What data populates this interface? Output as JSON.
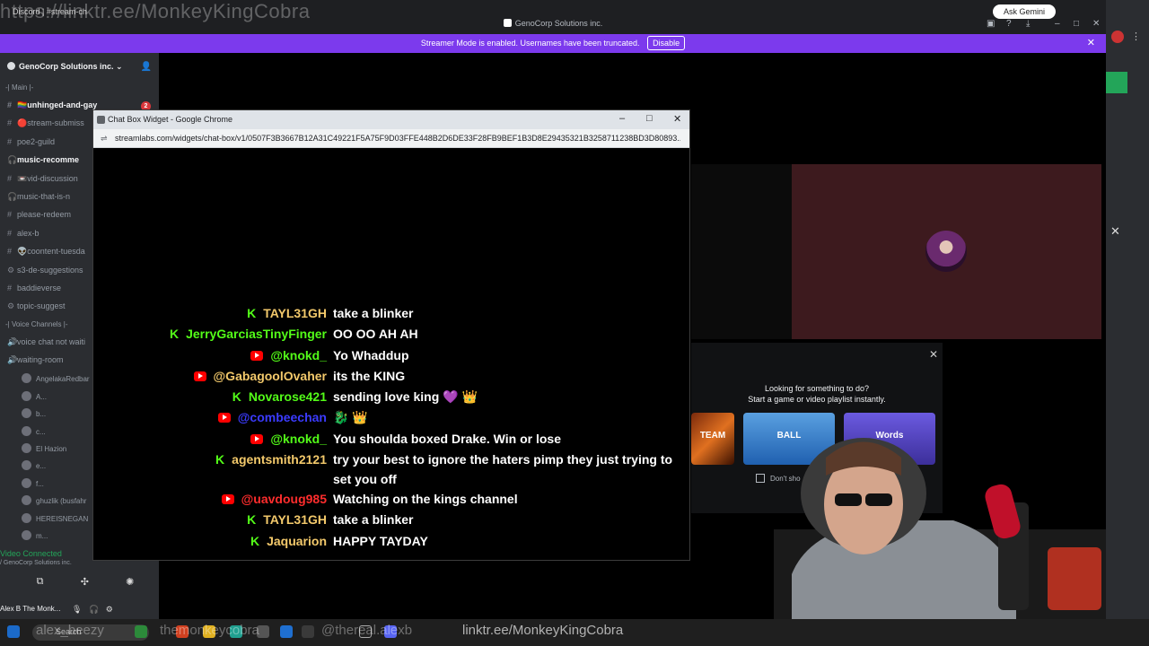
{
  "overlay": {
    "top_link": "https://linktr.ee/MonkeyKingCobra",
    "bottom_link": "linktr.ee/MonkeyKingCobra",
    "bottom_social_1": "themonkeycobra",
    "bottom_social_2": "@thereal.alexb",
    "bottom_social_3": "alex_beezy"
  },
  "discord": {
    "window_title": "GenoCorp Solutions inc.",
    "tab_mini": "Discord | #stream-ch",
    "ask_gemini": "Ask Gemini",
    "banner_text": "Streamer Mode is enabled. Usernames have been truncated.",
    "banner_button": "Disable",
    "server_name": "GenoCorp Solutions inc.",
    "categories": [
      "-| Main |-",
      "-| Voice Channels |-"
    ],
    "channels": [
      {
        "name": "🏳️‍🌈unhinged-and-gay",
        "icon": "#",
        "badge": "2",
        "unread": true
      },
      {
        "name": "🔴stream-submiss",
        "icon": "#",
        "badge": "",
        "unread": false
      },
      {
        "name": "poe2-guild",
        "icon": "#",
        "badge": "",
        "unread": false
      },
      {
        "name": "music-recomme",
        "icon": "🎧",
        "badge": "",
        "unread": true
      },
      {
        "name": "📼vid-discussion",
        "icon": "#",
        "badge": "",
        "unread": false
      },
      {
        "name": "music-that-is-n",
        "icon": "🎧",
        "badge": "",
        "unread": false
      },
      {
        "name": "please-redeem",
        "icon": "#",
        "badge": "",
        "unread": false
      },
      {
        "name": "alex-b",
        "icon": "#",
        "badge": "",
        "unread": false
      },
      {
        "name": "👽coontent-tuesda",
        "icon": "#",
        "badge": "",
        "unread": false
      },
      {
        "name": "s3-de-suggestions",
        "icon": "⚙",
        "badge": "",
        "unread": false
      },
      {
        "name": "baddieverse",
        "icon": "#",
        "badge": "",
        "unread": false
      },
      {
        "name": "topic-suggest",
        "icon": "⚙",
        "badge": "",
        "unread": false
      }
    ],
    "voice_channels": [
      {
        "name": "voice chat not waiti",
        "icon": "🔊"
      },
      {
        "name": "waiting-room",
        "icon": "🔊"
      }
    ],
    "voice_users": [
      "AngelakaRedbar",
      "A...",
      "b...",
      "c...",
      "El Hazion",
      "e...",
      "f...",
      "ghuzlik (busfahr",
      "HEREISNEGAN",
      "m..."
    ],
    "voice_connected": "Video Connected",
    "voice_connected_sub": "/ GenoCorp Solutions inc.",
    "user_name": "Alex B The Monk..."
  },
  "chrome": {
    "window_title": "Chat Box Widget - Google Chrome",
    "url": "streamlabs.com/widgets/chat-box/v1/0507F3B3667B12A31C49221F5A75F9D03FFE448B2D6DE33F28FB9BEF1B3D8E29435321B3258711238BD3D80893..."
  },
  "chat": [
    {
      "platform": "kick",
      "user": "TAYL31GH",
      "color": "#f3c96b",
      "text": "take a blinker"
    },
    {
      "platform": "kick",
      "user": "JerryGarciasTinyFinger",
      "color": "#53fc18",
      "text": "OO OO AH AH"
    },
    {
      "platform": "youtube",
      "user": "@knokd_",
      "color": "#53fc18",
      "text": "Yo Whaddup"
    },
    {
      "platform": "youtube",
      "user": "@GabagoolOvaher",
      "color": "#f3c96b",
      "text": "its the KING"
    },
    {
      "platform": "kick",
      "user": "Novarose421",
      "color": "#53fc18",
      "text": "sending love king 💜 👑"
    },
    {
      "platform": "youtube",
      "user": "@combeechan",
      "color": "#3b3bff",
      "text": "🐉 👑"
    },
    {
      "platform": "youtube",
      "user": "@knokd_",
      "color": "#53fc18",
      "text": "You shoulda boxed Drake. Win or lose"
    },
    {
      "platform": "kick",
      "user": "agentsmith2121",
      "color": "#f3c96b",
      "text": "try your best to ignore the haters pimp they just trying to set you off"
    },
    {
      "platform": "youtube",
      "user": "@uavdoug985",
      "color": "#ff2d2d",
      "text": "Watching on the kings channel"
    },
    {
      "platform": "kick",
      "user": "TAYL31GH",
      "color": "#f3c96b",
      "text": "take a blinker"
    },
    {
      "platform": "kick",
      "user": "Jaquarion",
      "color": "#f3c96b",
      "text": "HAPPY TAYDAY"
    }
  ],
  "activity": {
    "line1": "Looking for something to do?",
    "line2": "Start a game or video playlist instantly.",
    "tile_1": "TEAM",
    "tile_2": "BALL",
    "tile_3": "Words",
    "dont_show": "Don't sho"
  },
  "taskbar": {
    "search_placeholder": "Search"
  },
  "colors": {
    "banner": "#7c3aed",
    "kick": "#53fc18",
    "youtube": "#ff0000",
    "sidebar": "#2b2d31"
  }
}
